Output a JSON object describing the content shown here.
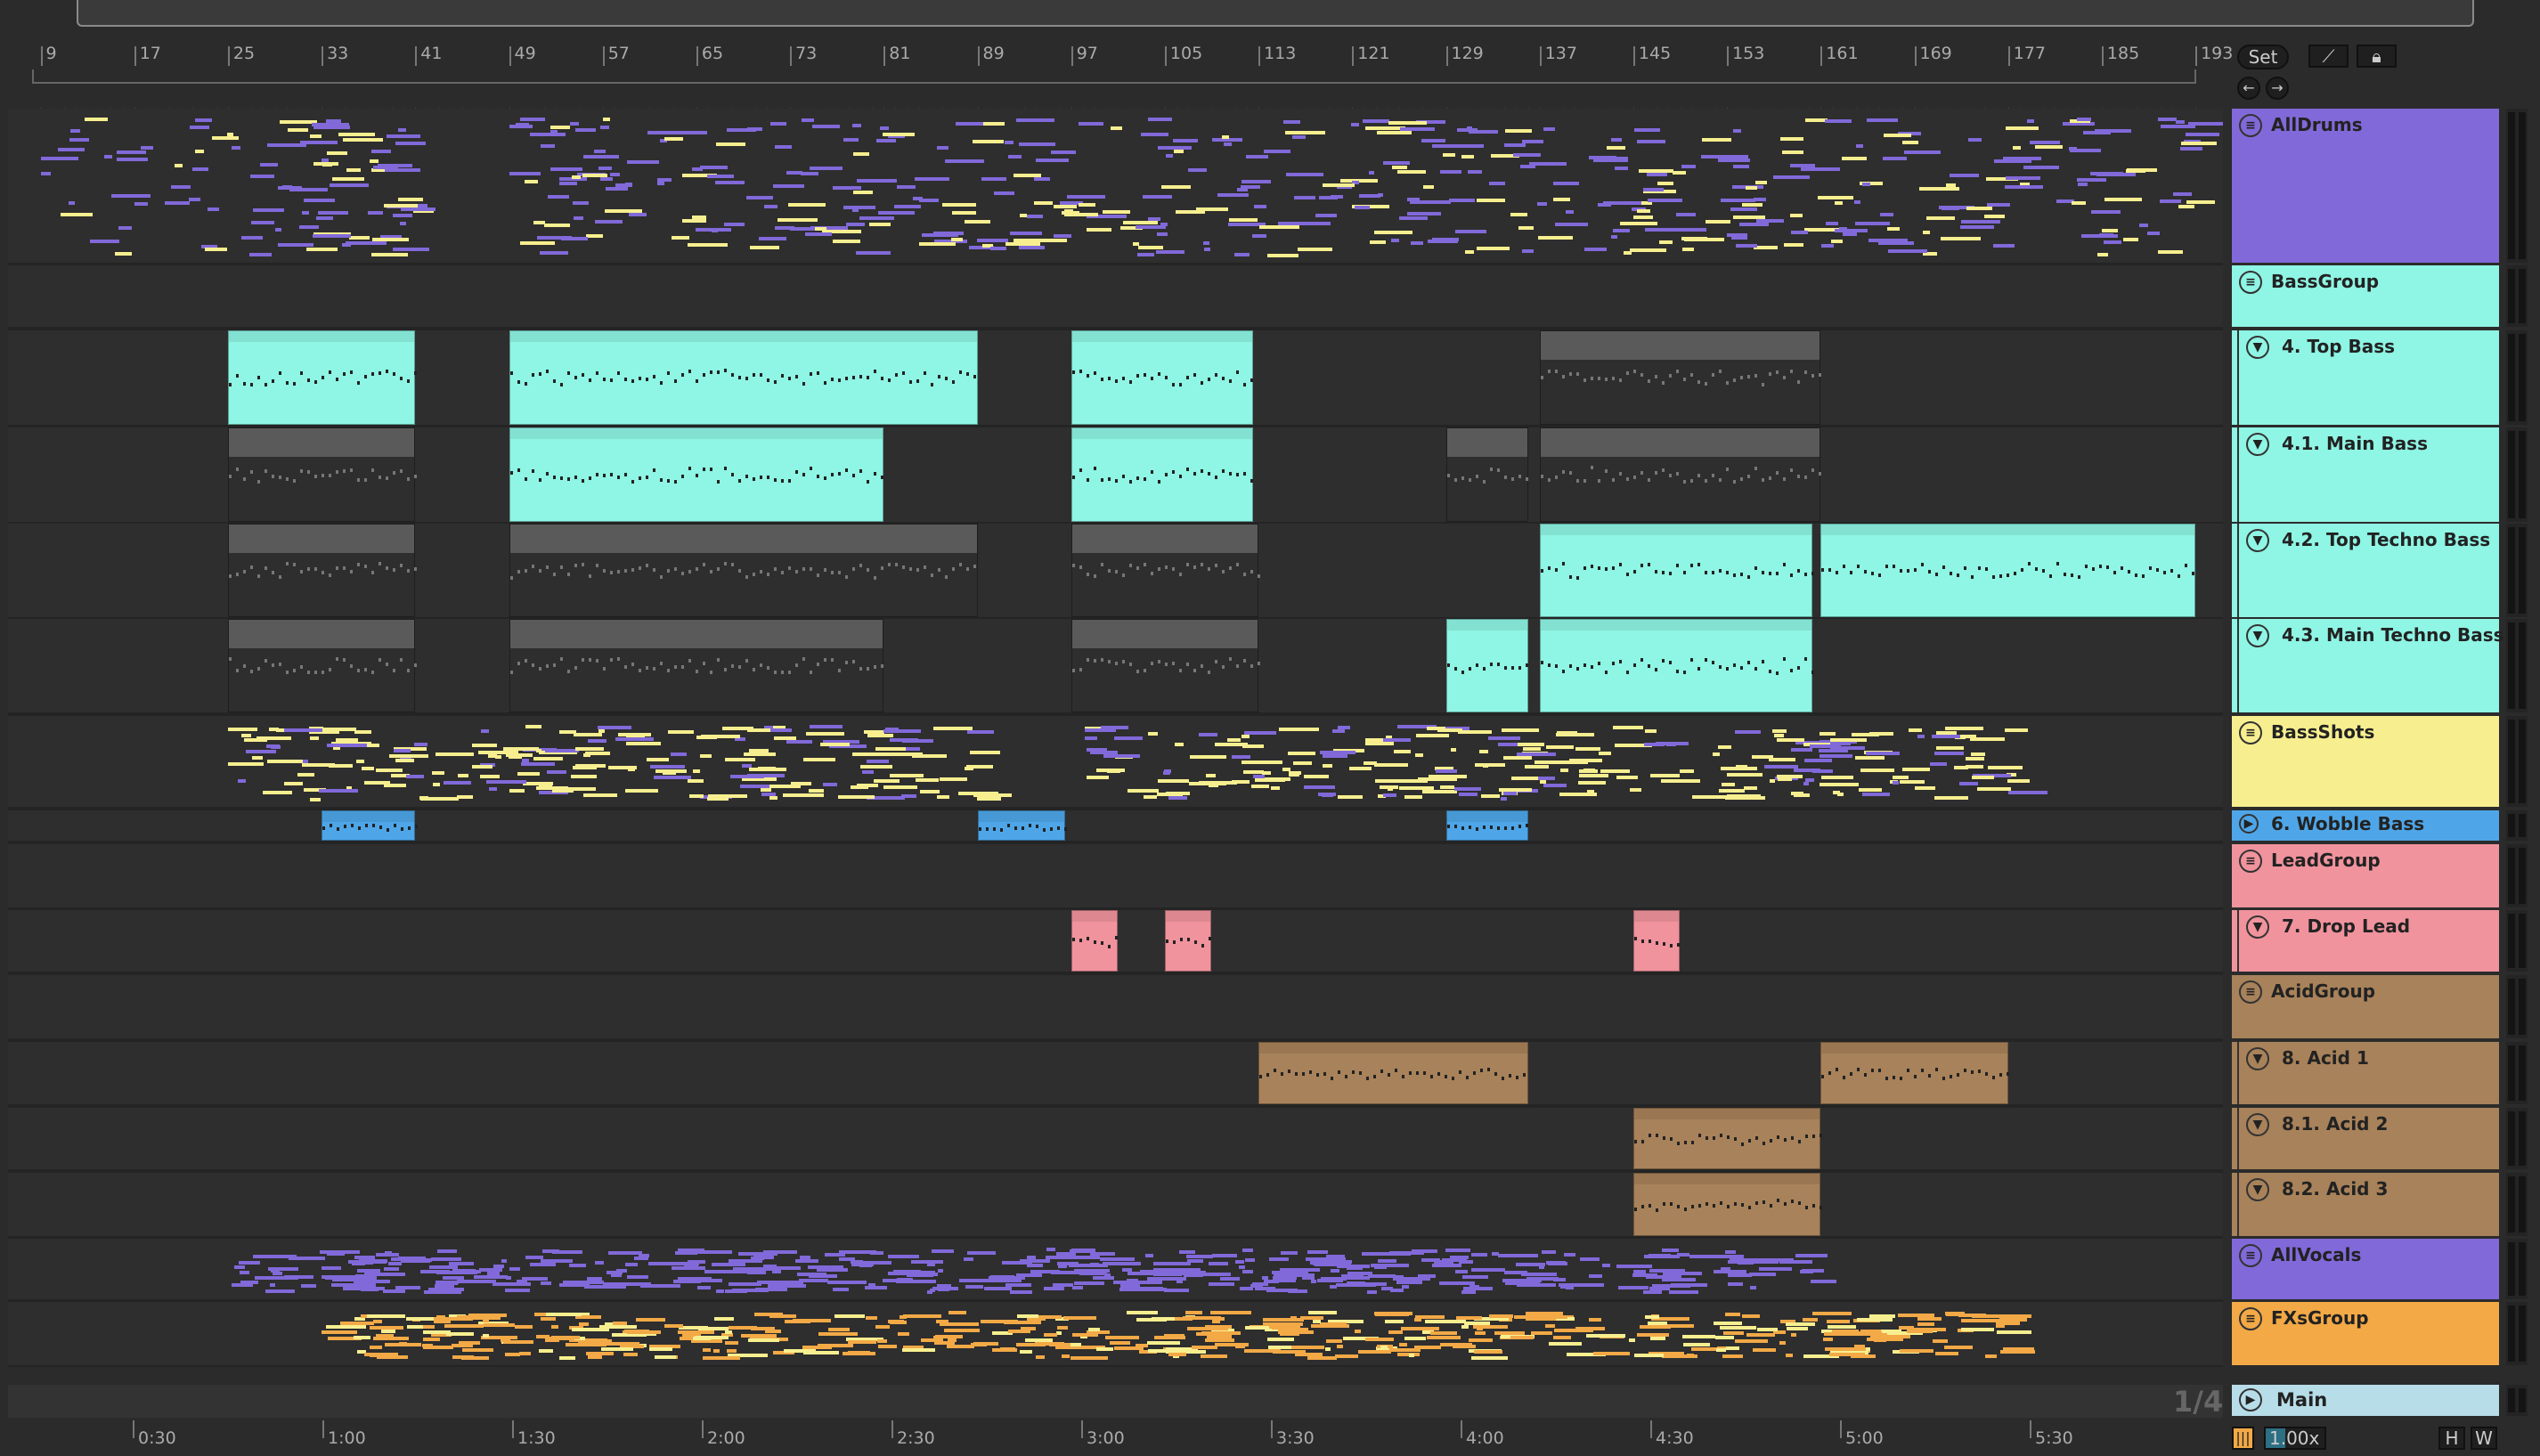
{
  "ruler": {
    "bars": [
      9,
      17,
      25,
      33,
      41,
      49,
      57,
      65,
      73,
      81,
      89,
      97,
      105,
      113,
      121,
      129,
      137,
      145,
      153,
      161,
      169,
      177,
      185,
      193
    ]
  },
  "time_ruler": [
    "0:30",
    "1:00",
    "1:30",
    "2:00",
    "2:30",
    "3:00",
    "3:30",
    "4:00",
    "4:30",
    "5:00",
    "5:30"
  ],
  "controls": {
    "set_label": "Set",
    "follow_icon": "draw-icon",
    "lock_icon": "lock-icon",
    "back_icon": "arrow-left-icon",
    "forward_icon": "arrow-right-icon",
    "grid_label": "1/4",
    "zoom_value": "1.00x",
    "h_label": "H",
    "w_label": "W"
  },
  "colors": {
    "purple": "#8169d9",
    "cyan": "#8ff5e4",
    "yellow": "#f7ef8f",
    "blue": "#4ea6e8",
    "pink": "#f0939d",
    "tan": "#a8825a",
    "orange": "#f2a946",
    "main": "#b7dde8",
    "gray": "#5a5a5a"
  },
  "tracks": [
    {
      "name": "AllDrums",
      "type": "group",
      "color": "#8169d9",
      "clips": []
    },
    {
      "name": "BassGroup",
      "type": "group",
      "color": "#8ff5e4",
      "clips": []
    },
    {
      "name": "4. Top Bass",
      "type": "track",
      "color": "#8ff5e4",
      "clips": [
        [
          25,
          41,
          "c"
        ],
        [
          49,
          89,
          "c"
        ],
        [
          97,
          112.5,
          "c"
        ],
        [
          137,
          161,
          "g"
        ]
      ]
    },
    {
      "name": "4.1. Main Bass",
      "type": "track",
      "color": "#8ff5e4",
      "clips": [
        [
          25,
          41,
          "g"
        ],
        [
          49,
          81,
          "c"
        ],
        [
          97,
          112.5,
          "c"
        ],
        [
          129,
          136,
          "g"
        ],
        [
          137,
          161,
          "g"
        ]
      ]
    },
    {
      "name": "4.2. Top Techno Bass",
      "type": "track",
      "color": "#8ff5e4",
      "clips": [
        [
          25,
          41,
          "g"
        ],
        [
          49,
          89,
          "g"
        ],
        [
          97,
          113,
          "g"
        ],
        [
          137,
          160.3,
          "c"
        ],
        [
          161,
          193,
          "c"
        ]
      ]
    },
    {
      "name": "4.3. Main Techno Bass",
      "type": "track",
      "color": "#8ff5e4",
      "clips": [
        [
          25,
          41,
          "g"
        ],
        [
          49,
          81,
          "g"
        ],
        [
          97,
          113,
          "g"
        ],
        [
          129,
          136,
          "c"
        ],
        [
          137,
          160.3,
          "c"
        ]
      ]
    },
    {
      "name": "BassShots",
      "type": "group",
      "color": "#f7ef8f",
      "clips": []
    },
    {
      "name": "6. Wobble Bass",
      "type": "play",
      "color": "#4ea6e8",
      "clips": [
        [
          33,
          41,
          "c"
        ],
        [
          89,
          96.5,
          "c"
        ],
        [
          129,
          136,
          "c"
        ]
      ]
    },
    {
      "name": "LeadGroup",
      "type": "group",
      "color": "#f0939d",
      "clips": []
    },
    {
      "name": "7. Drop Lead",
      "type": "track",
      "color": "#f0939d",
      "clips": [
        [
          97,
          101,
          "c"
        ],
        [
          105,
          109,
          "c"
        ],
        [
          145,
          149,
          "c"
        ]
      ]
    },
    {
      "name": "AcidGroup",
      "type": "group",
      "color": "#a8825a",
      "clips": []
    },
    {
      "name": "8. Acid 1",
      "type": "track",
      "color": "#a8825a",
      "clips": [
        [
          113,
          136,
          "c"
        ],
        [
          161,
          177,
          "c"
        ]
      ]
    },
    {
      "name": "8.1. Acid 2",
      "type": "track",
      "color": "#a8825a",
      "clips": [
        [
          145,
          161,
          "c"
        ]
      ]
    },
    {
      "name": "8.2. Acid 3",
      "type": "track",
      "color": "#a8825a",
      "clips": [
        [
          145,
          161,
          "c"
        ]
      ]
    },
    {
      "name": "AllVocals",
      "type": "group",
      "color": "#8169d9",
      "clips": []
    },
    {
      "name": "FXsGroup",
      "type": "group",
      "color": "#f2a946",
      "clips": []
    }
  ],
  "main_track": {
    "name": "Main",
    "color": "#b7dde8"
  }
}
